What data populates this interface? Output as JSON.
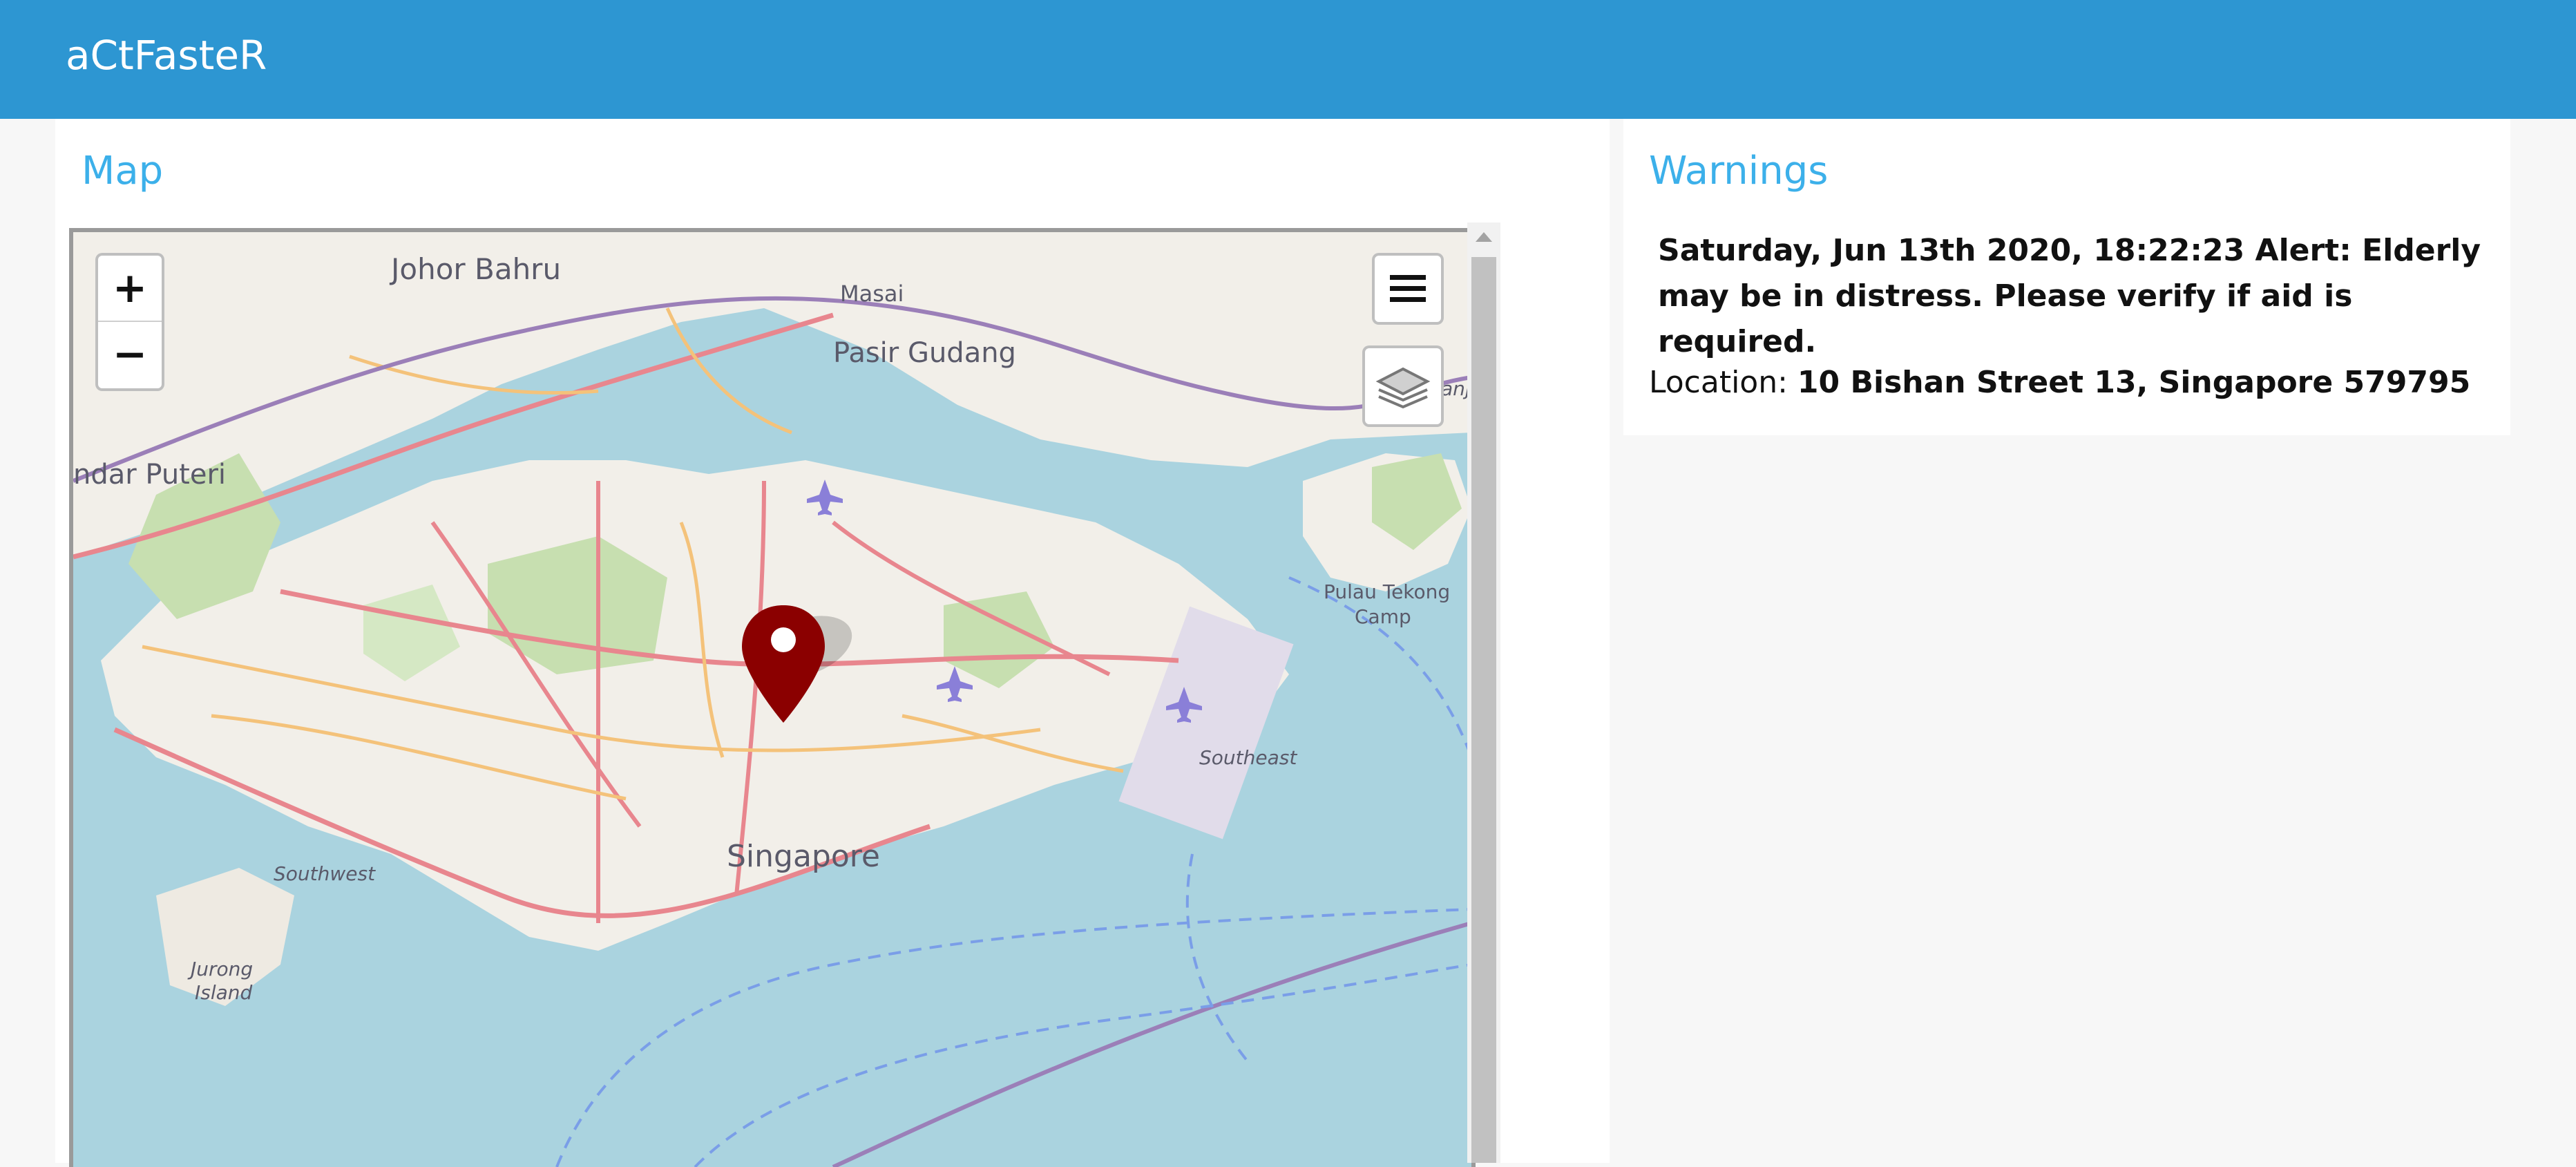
{
  "header": {
    "app_title": "aCtFasteR",
    "bar_color": "#2d96d2"
  },
  "map_panel": {
    "title": "Map",
    "zoom_in_label": "+",
    "zoom_out_label": "−",
    "menu_icon": "hamburger-menu-icon",
    "layers_icon": "layers-icon",
    "marker_icon": "map-pin-icon",
    "place_labels": {
      "johor_bahru": "Johor Bahru",
      "masai": "Masai",
      "pasir_gudang": "Pasir Gudang",
      "bandar_puteri": "ndar Puteri",
      "pulau_tekong": "Pulau Tekong",
      "pulau_tekong_2": "Camp",
      "singapore": "Singapore",
      "southwest": "Southwest",
      "southeast": "Southeast",
      "jurong": "Jurong",
      "jurong_2": "Island",
      "kanji_edge": "anj"
    }
  },
  "warnings_panel": {
    "title": "Warnings",
    "alert_text": "Saturday, Jun 13th 2020, 18:22:23 Alert: Elderly may be in distress. Please verify if aid is required.",
    "location_label": "Location: ",
    "location_value": "10 Bishan Street 13, Singapore 579795",
    "title_color": "#3cb0ea"
  }
}
